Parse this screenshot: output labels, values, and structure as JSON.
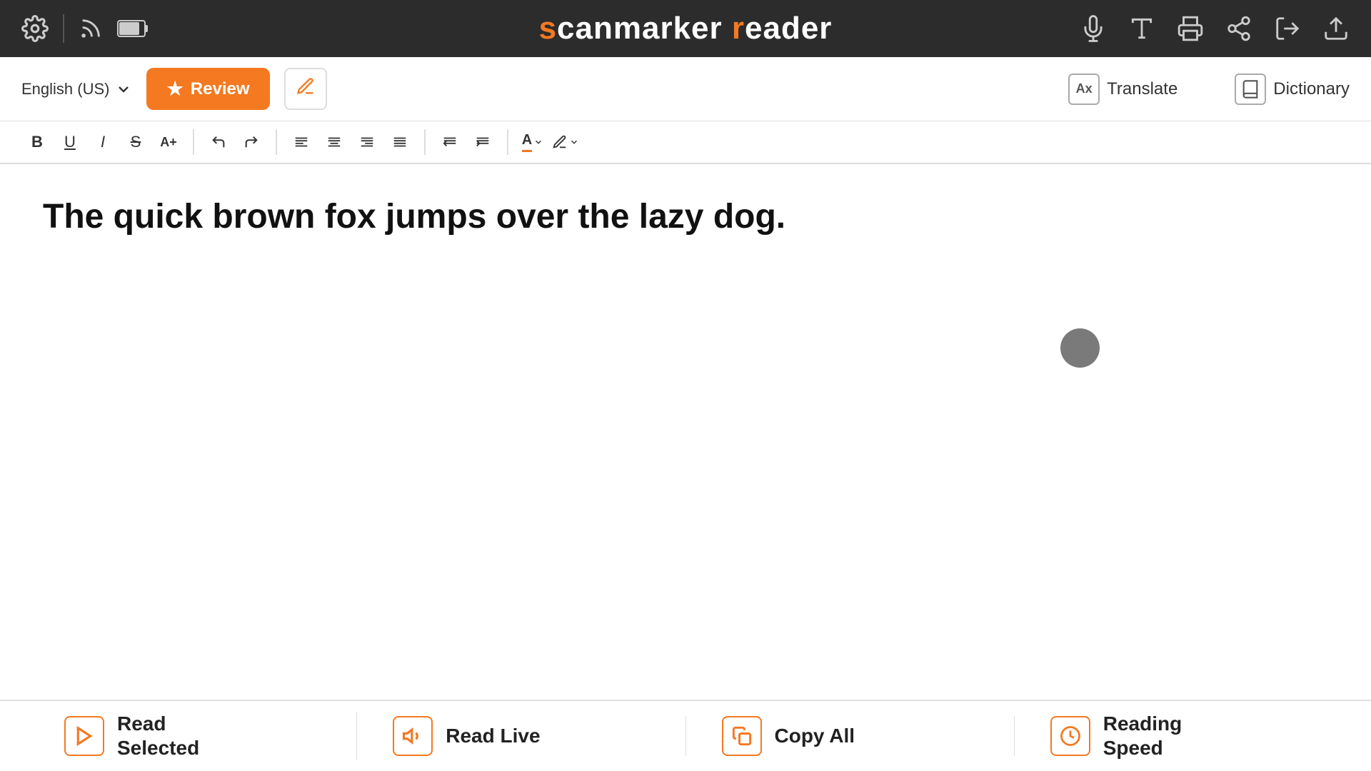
{
  "topbar": {
    "app_title_start": "s",
    "app_title_rest": "canmarker ",
    "app_title_r": "r",
    "app_title_end": "eader"
  },
  "secondary": {
    "language": "English (US)",
    "review_label": "Review",
    "translate_label": "Translate",
    "dictionary_label": "Dictionary"
  },
  "editor": {
    "content": "The quick brown fox jumps over the lazy dog."
  },
  "bottom": {
    "read_selected_label": "Read\nSelected",
    "read_selected_line1": "Read",
    "read_selected_line2": "Selected",
    "read_live_label": "Read Live",
    "copy_all_label": "Copy All",
    "reading_speed_line1": "Reading",
    "reading_speed_line2": "Speed"
  }
}
